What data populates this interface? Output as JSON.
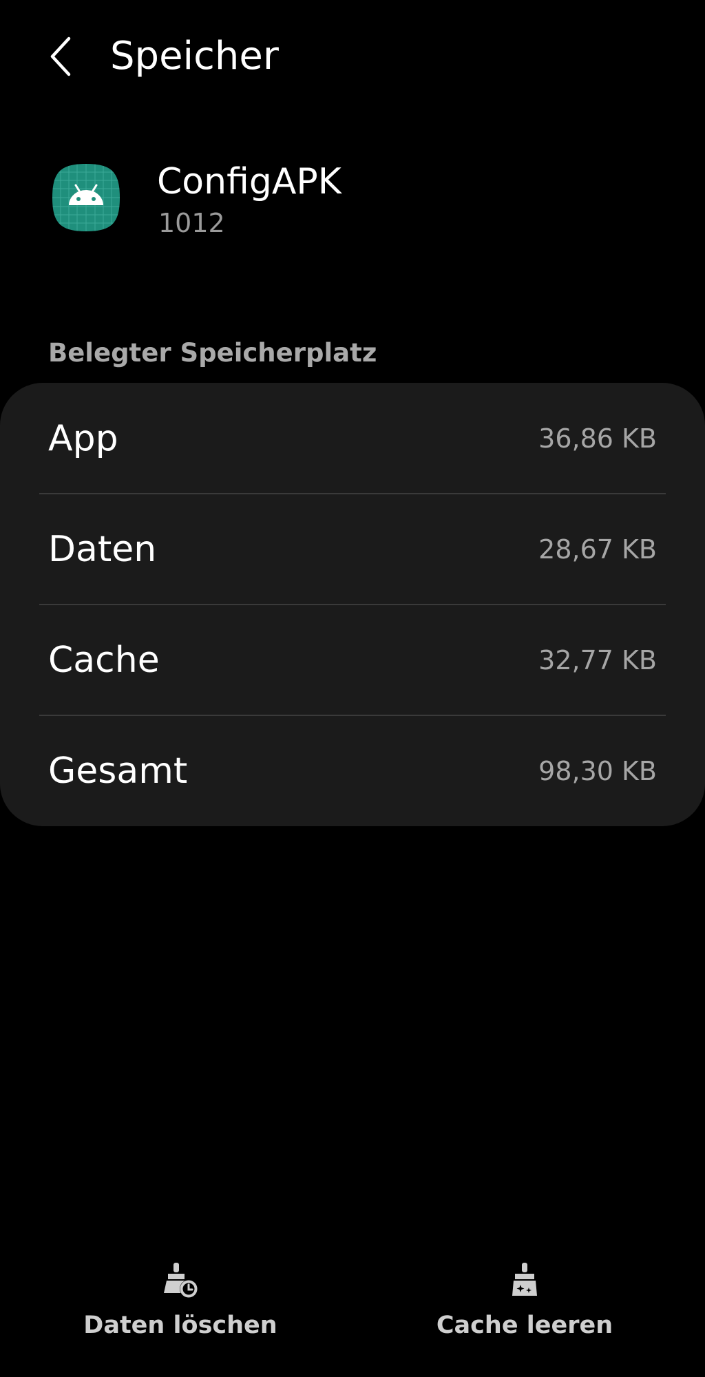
{
  "header": {
    "back_icon": "chevron-left-icon",
    "title": "Speicher"
  },
  "app": {
    "icon": "android-app-icon",
    "icon_color": "#1f8f7c",
    "name": "ConfigAPK",
    "version": "1012"
  },
  "storage": {
    "section_label": "Belegter Speicherplatz",
    "rows": [
      {
        "label": "App",
        "value": "36,86 KB"
      },
      {
        "label": "Daten",
        "value": "28,67 KB"
      },
      {
        "label": "Cache",
        "value": "32,77 KB"
      },
      {
        "label": "Gesamt",
        "value": "98,30 KB"
      }
    ]
  },
  "actions": {
    "clear_data": {
      "label": "Daten löschen",
      "icon": "broom-clock-icon"
    },
    "clear_cache": {
      "label": "Cache leeren",
      "icon": "broom-sparkle-icon"
    }
  },
  "colors": {
    "background": "#000000",
    "card": "#1b1b1b",
    "secondary_text": "#a6a6a6"
  }
}
